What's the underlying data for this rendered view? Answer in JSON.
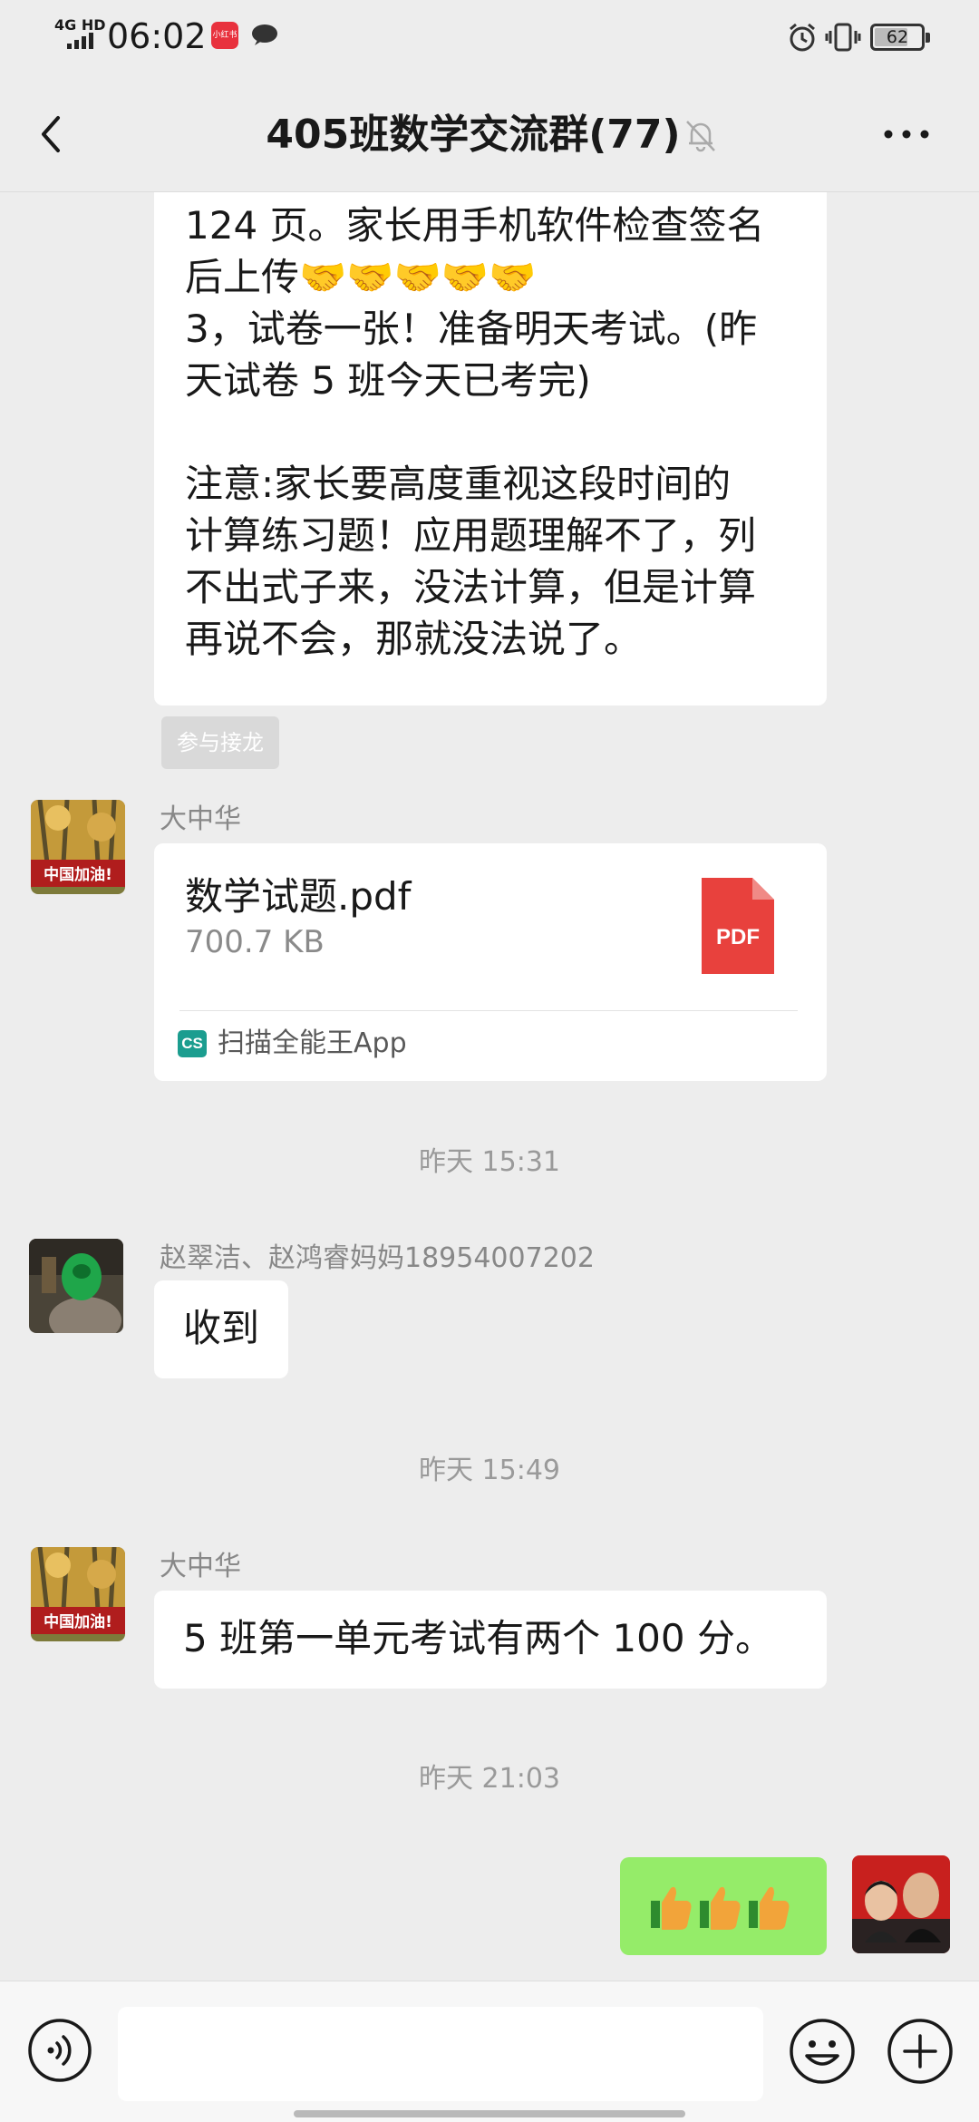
{
  "status_bar": {
    "network": "4G HD",
    "time": "06:02",
    "app_badge": "小红书",
    "battery": "62"
  },
  "header": {
    "title": "405班数学交流群(77)",
    "back_icon": "chevron-left-icon",
    "mute_icon": "bell-off-icon",
    "more_icon": "more-dots-icon"
  },
  "messages": {
    "long_text": "124 页。家长用手机软件检查签名\n后上传🤝🤝🤝🤝🤝\n3，试卷一张！准备明天考试。(昨\n天试卷 5 班今天已考完)\n\n注意:家长要高度重视这段时间的\n计算练习题！应用题理解不了，列\n不出式子来，没法计算，但是计算\n再说不会，那就没法说了。",
    "relay_button": "参与接龙",
    "file": {
      "sender": "大中华",
      "name": "数学试题.pdf",
      "size": "700.7 KB",
      "icon_text": "PDF",
      "source_icon_text": "CS",
      "source": "扫描全能王App"
    },
    "ts1": "昨天 15:31",
    "reply1": {
      "sender": "赵翠洁、赵鸿睿妈妈18954007202",
      "text": "收到"
    },
    "ts2": "昨天 15:49",
    "reply2": {
      "sender": "大中华",
      "text": "5 班第一单元考试有两个 100 分。"
    },
    "ts3": "昨天 21:03",
    "mine": {
      "text": "👍👍👍"
    },
    "avatar_caption": "中国加油!"
  },
  "input_bar": {
    "voice_icon": "voice-icon",
    "input_value": "",
    "emoji_icon": "emoji-icon",
    "plus_icon": "plus-icon"
  },
  "colors": {
    "background": "#ededed",
    "my_bubble": "#95ec69",
    "pdf_red": "#e8413d",
    "cs_teal": "#1b9d8f"
  }
}
